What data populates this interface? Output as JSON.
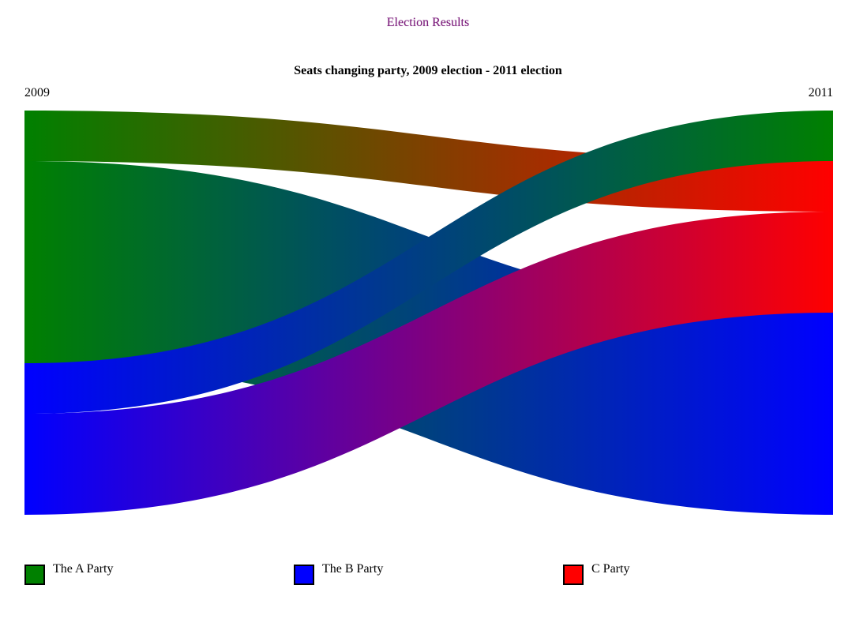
{
  "page_title": "Election Results",
  "chart_data": {
    "type": "sankey",
    "title": "Seats changing party, 2009 election - 2011 election",
    "left_label": "2009",
    "right_label": "2011",
    "parties": [
      {
        "name": "The A Party",
        "color": "#008000"
      },
      {
        "name": "The B Party",
        "color": "#0000ff"
      },
      {
        "name": "C Party",
        "color": "#ff0000"
      }
    ],
    "flows": [
      {
        "from": "The A Party",
        "to": "C Party",
        "value": 5
      },
      {
        "from": "The A Party",
        "to": "The B Party",
        "value": 20
      },
      {
        "from": "The B Party",
        "to": "The A Party",
        "value": 5
      },
      {
        "from": "The B Party",
        "to": "C Party",
        "value": 10
      }
    ],
    "left_order": [
      "The A Party",
      "The B Party"
    ],
    "right_order": [
      "The A Party",
      "C Party",
      "The B Party"
    ],
    "legend_position": "bottom"
  }
}
